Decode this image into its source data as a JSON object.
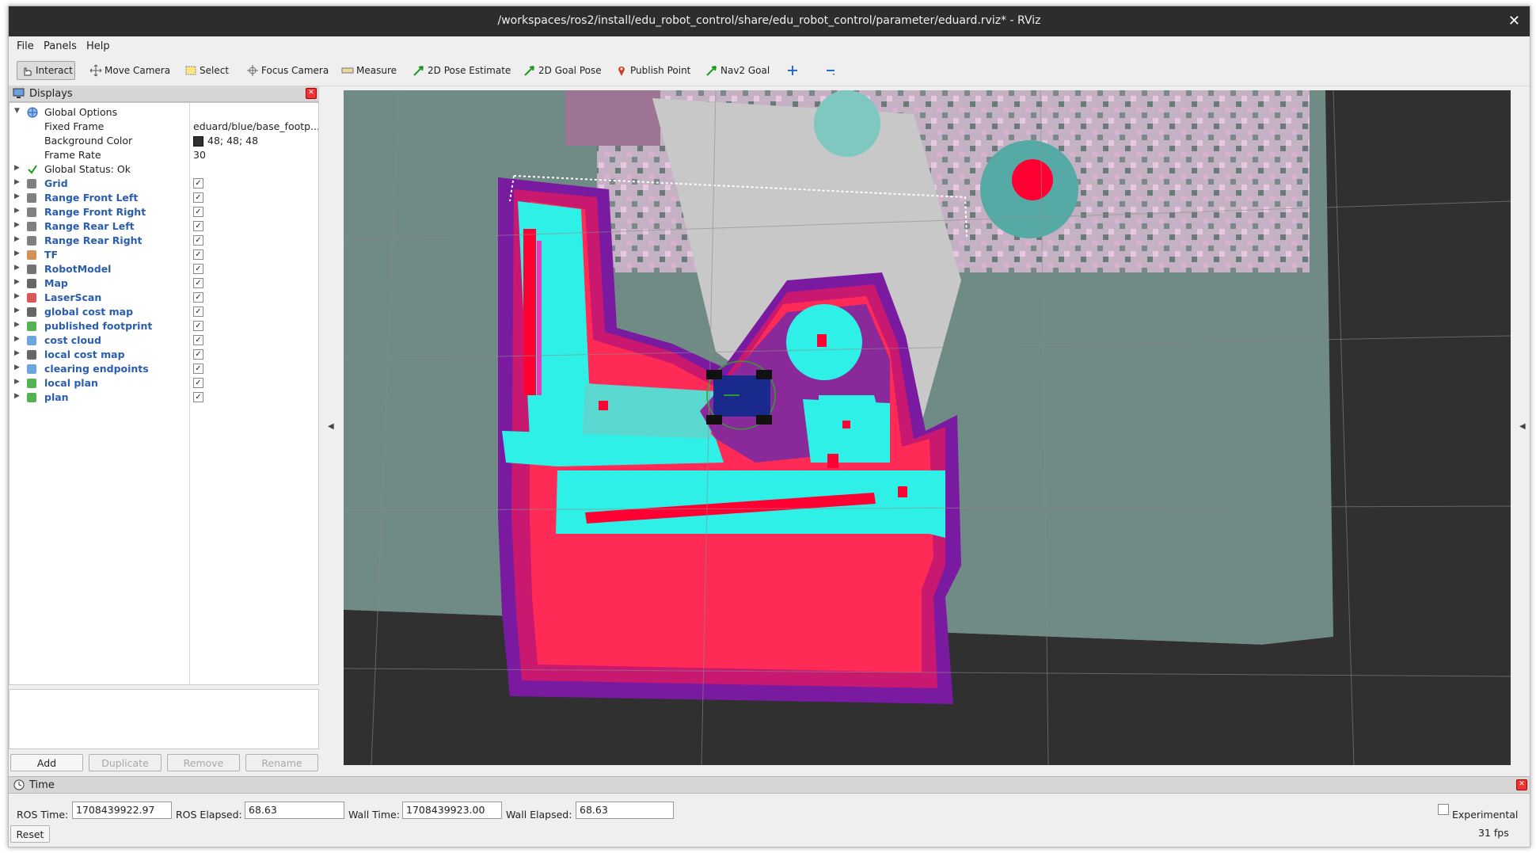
{
  "window": {
    "title": "/workspaces/ros2/install/edu_robot_control/share/edu_robot_control/parameter/eduard.rviz* - RViz"
  },
  "menu": [
    "File",
    "Panels",
    "Help"
  ],
  "toolbar": {
    "tools": [
      "Interact",
      "Move Camera",
      "Select",
      "Focus Camera",
      "Measure",
      "2D Pose Estimate",
      "2D Goal Pose",
      "Publish Point",
      "Nav2 Goal"
    ]
  },
  "displays": {
    "title": "Displays",
    "global_options": {
      "label": "Global Options",
      "fixed_frame_label": "Fixed Frame",
      "fixed_frame_value": "eduard/blue/base_footp...",
      "background_color_label": "Background Color",
      "background_color_value": "48; 48; 48",
      "background_color_hex": "#303030",
      "frame_rate_label": "Frame Rate",
      "frame_rate_value": "30"
    },
    "global_status": "Global Status: Ok",
    "items": [
      {
        "name": "Grid",
        "checked": true
      },
      {
        "name": "Range Front Left",
        "checked": true
      },
      {
        "name": "Range Front Right",
        "checked": true
      },
      {
        "name": "Range Rear Left",
        "checked": true
      },
      {
        "name": "Range Rear Right",
        "checked": true
      },
      {
        "name": "TF",
        "checked": true
      },
      {
        "name": "RobotModel",
        "checked": true
      },
      {
        "name": "Map",
        "checked": true
      },
      {
        "name": "LaserScan",
        "checked": true
      },
      {
        "name": "global cost map",
        "checked": true
      },
      {
        "name": "published footprint",
        "checked": true
      },
      {
        "name": "cost cloud",
        "checked": true
      },
      {
        "name": "local cost map",
        "checked": true
      },
      {
        "name": "clearing endpoints",
        "checked": true
      },
      {
        "name": "local plan",
        "checked": true
      },
      {
        "name": "plan",
        "checked": true
      }
    ],
    "buttons": {
      "add": "Add",
      "duplicate": "Duplicate",
      "remove": "Remove",
      "rename": "Rename"
    }
  },
  "time": {
    "title": "Time",
    "ros_time_label": "ROS Time:",
    "ros_time": "1708439922.97",
    "ros_elapsed_label": "ROS Elapsed:",
    "ros_elapsed": "68.63",
    "wall_time_label": "Wall Time:",
    "wall_time": "1708439923.00",
    "wall_elapsed_label": "Wall Elapsed:",
    "wall_elapsed": "68.63",
    "experimental_label": "Experimental",
    "reset": "Reset",
    "fps": "31 fps"
  },
  "colors": {
    "accent_blue": "#2a5db0",
    "viewport_bg": "#303030",
    "costmap_cyan": "#2ff0e6",
    "costmap_red": "#ff0033",
    "costmap_magenta": "#c01aa0",
    "map_free": "#c8c8c8",
    "robot_blue": "#1a2a8c"
  }
}
